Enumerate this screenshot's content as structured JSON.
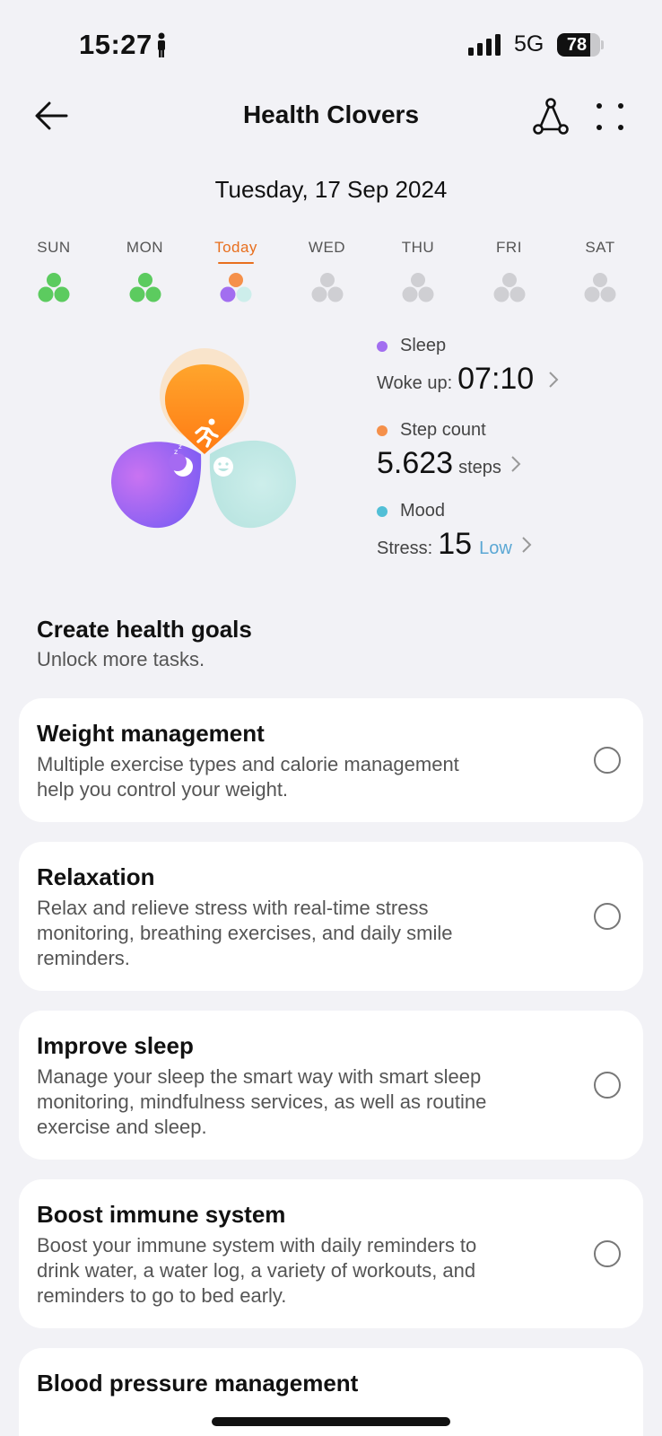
{
  "status_bar": {
    "time": "15:27",
    "network": "5G",
    "battery": "78",
    "battery_level": 0.78
  },
  "header": {
    "title": "Health Clovers"
  },
  "date": "Tuesday, 17 Sep 2024",
  "week": [
    {
      "label": "SUN",
      "state": "complete"
    },
    {
      "label": "MON",
      "state": "complete"
    },
    {
      "label": "Today",
      "state": "today"
    },
    {
      "label": "WED",
      "state": "future"
    },
    {
      "label": "THU",
      "state": "future"
    },
    {
      "label": "FRI",
      "state": "future"
    },
    {
      "label": "SAT",
      "state": "future"
    }
  ],
  "colors": {
    "sleep": "#a26ef0",
    "steps": "#f5904a",
    "mood": "#52bfd6",
    "complete": "#5ccb5f",
    "future": "#cfcfd3",
    "accent": "#e86f1e"
  },
  "metrics": {
    "sleep": {
      "label": "Sleep",
      "prefix": "Woke up:",
      "value": "07:10"
    },
    "steps": {
      "label": "Step count",
      "value": "5.623",
      "unit": "steps"
    },
    "mood": {
      "label": "Mood",
      "prefix": "Stress:",
      "value": "15",
      "level": "Low"
    }
  },
  "goals": {
    "title": "Create health goals",
    "subtitle": "Unlock more tasks.",
    "items": [
      {
        "title": "Weight management",
        "lines": [
          "Multiple exercise types and calorie management",
          "help you control your weight."
        ]
      },
      {
        "title": "Relaxation",
        "lines": [
          "Relax and relieve stress with real-time stress",
          "monitoring, breathing exercises, and daily smile",
          "reminders."
        ]
      },
      {
        "title": "Improve sleep",
        "lines": [
          "Manage your sleep the smart way with smart sleep",
          "monitoring, mindfulness services, as well as routine",
          "exercise and sleep."
        ]
      },
      {
        "title": "Boost immune system",
        "lines": [
          "Boost your immune system with daily reminders to",
          "drink water, a water log, a variety of workouts, and",
          "reminders to go to bed early."
        ]
      },
      {
        "title": "Blood pressure management",
        "lines": []
      }
    ]
  }
}
